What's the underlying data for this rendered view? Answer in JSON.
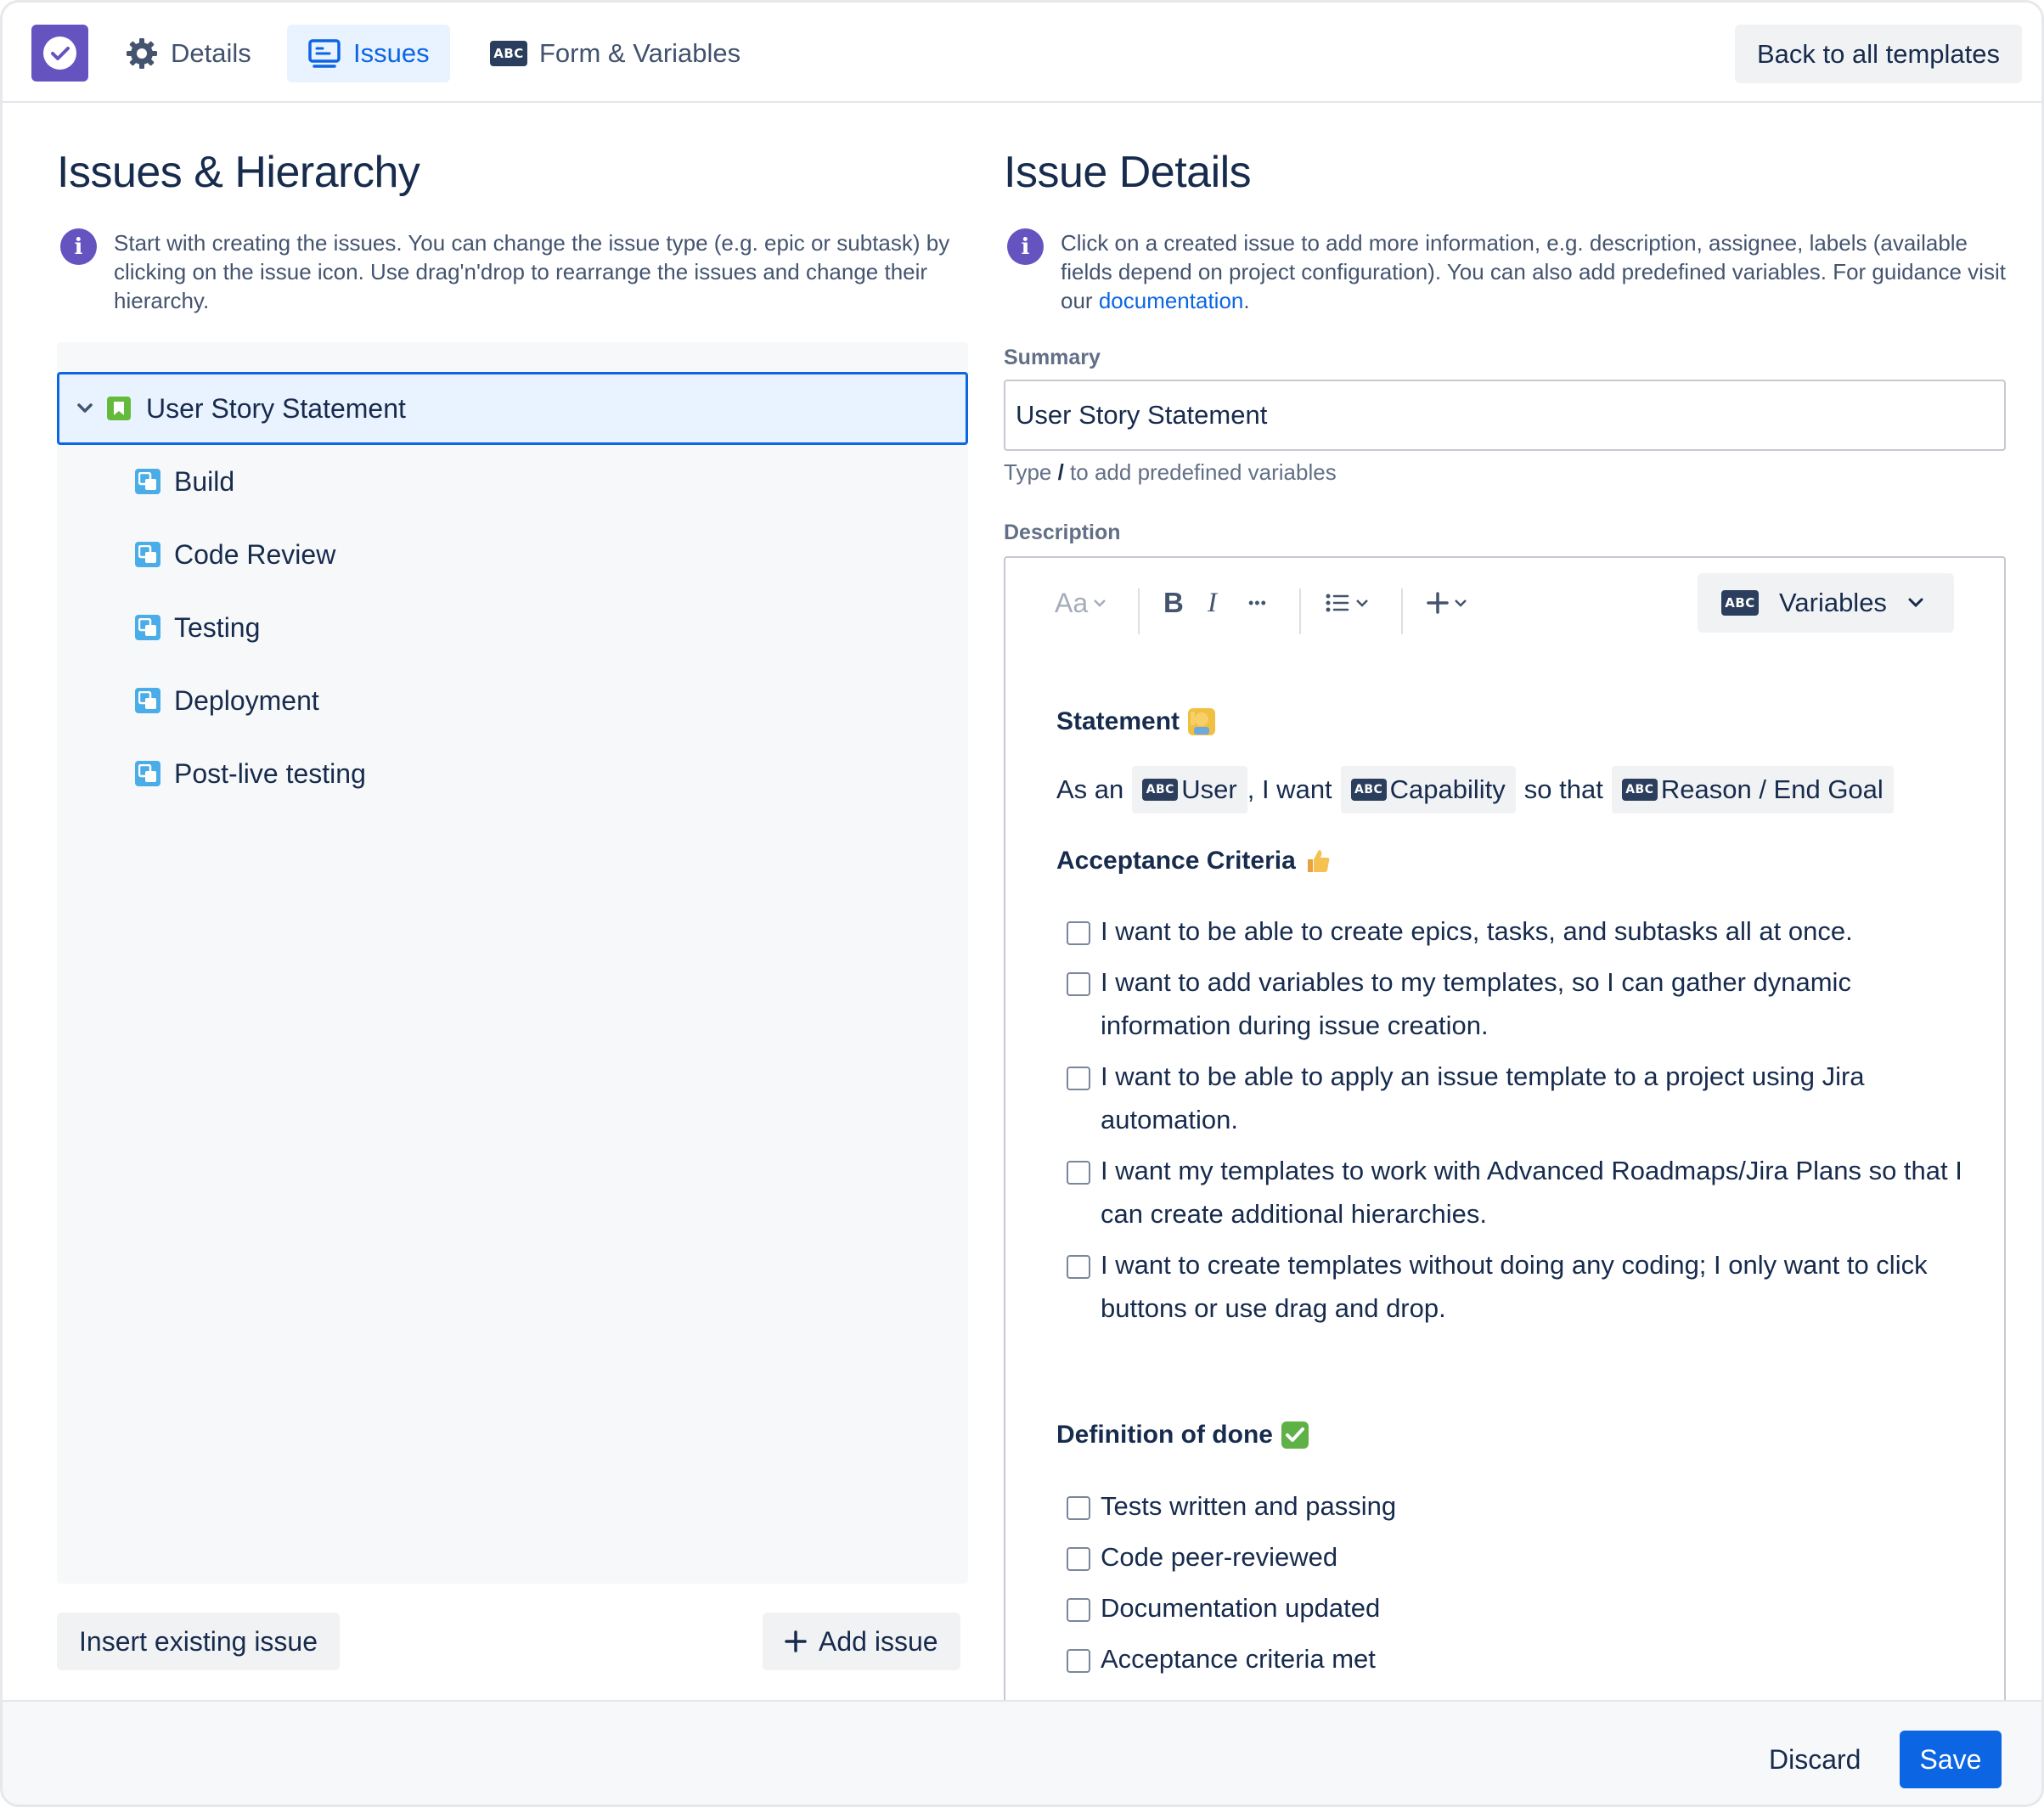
{
  "nav": {
    "tabs": [
      {
        "label": "Details",
        "icon": "gear-icon"
      },
      {
        "label": "Issues",
        "icon": "monitor-icon",
        "active": true
      },
      {
        "label": "Form & Variables",
        "icon": "abc-icon"
      }
    ],
    "abc": "ABC",
    "back_label": "Back to all templates"
  },
  "left": {
    "title": "Issues & Hierarchy",
    "info": "Start with creating the issues. You can change the issue type (e.g. epic or subtask) by clicking on the issue icon. Use drag'n'drop to rearrange the issues and change their hierarchy.",
    "tree": {
      "root": "User Story Statement",
      "children": [
        "Build",
        "Code Review",
        "Testing",
        "Deployment",
        "Post-live testing"
      ]
    },
    "insert_label": "Insert existing issue",
    "add_label": "Add issue"
  },
  "right": {
    "title": "Issue Details",
    "info_prefix": "Click on a created issue to add more information, e.g. description, assignee, labels (available fields depend on project configuration). You can also add predefined variables. For guidance visit our ",
    "info_link": "documentation",
    "info_suffix": ".",
    "summary_label": "Summary",
    "summary_value": "User Story Statement",
    "hint_prefix": "Type ",
    "hint_key": "/",
    "hint_suffix": " to add predefined variables",
    "description_label": "Description",
    "toolbar": {
      "text_style": "Aa",
      "bold": "B",
      "italic": "I",
      "more": "•••",
      "variables_label": "Variables"
    },
    "doc": {
      "statement_heading": "Statement",
      "statement": {
        "as_an": "As an",
        "user": "User",
        "i_want": ", I want",
        "capability": "Capability",
        "so_that": "so that",
        "reason": "Reason / End Goal"
      },
      "acceptance_heading": "Acceptance Criteria",
      "acceptance": [
        "I want to be able to create epics, tasks, and subtasks all at once.",
        "I want to add variables to my templates, so I can gather dynamic information during issue creation.",
        "I want to be able to apply an issue template to a project using Jira automation.",
        "I want my templates to work with Advanced Roadmaps/Jira Plans so that I can create additional hierarchies.",
        "I want to create templates without doing any coding; I only want to click buttons or use drag and drop."
      ],
      "dod_heading": "Definition of done",
      "dod": [
        "Tests written and passing",
        "Code peer-reviewed",
        "Documentation updated",
        "Acceptance criteria met"
      ]
    }
  },
  "footer": {
    "discard_label": "Discard",
    "save_label": "Save"
  },
  "colors": {
    "accent": "#0C66E4",
    "brand": "#6554C0",
    "story": "#63BA3C",
    "subtask": "#4BADE8"
  }
}
